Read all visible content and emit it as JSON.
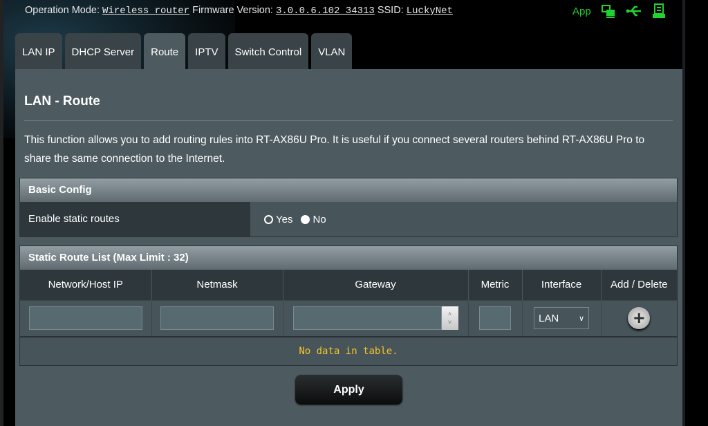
{
  "status": {
    "op_mode_label": "Operation Mode:",
    "op_mode": "Wireless router",
    "fw_label": "Firmware Version:",
    "fw": "3.0.0.6.102_34313",
    "ssid_label": "SSID:",
    "ssid": "LuckyNet",
    "app": "App",
    "icons": [
      "network-status-icon",
      "usb-icon",
      "printer-icon"
    ],
    "accent": "#21d330"
  },
  "tabs": [
    {
      "label": "LAN IP"
    },
    {
      "label": "DHCP Server"
    },
    {
      "label": "Route",
      "active": true
    },
    {
      "label": "IPTV"
    },
    {
      "label": "Switch Control"
    },
    {
      "label": "VLAN"
    }
  ],
  "page": {
    "title": "LAN - Route",
    "description": "This function allows you to add routing rules into RT-AX86U Pro. It is useful if you connect several routers behind RT-AX86U Pro to share the same connection to the Internet."
  },
  "basic": {
    "header": "Basic Config",
    "label": "Enable static routes",
    "yes": "Yes",
    "no": "No",
    "selected": "No"
  },
  "routes": {
    "header": "Static Route List (Max Limit : 32)",
    "columns": [
      "Network/Host IP",
      "Netmask",
      "Gateway",
      "Metric",
      "Interface",
      "Add / Delete"
    ],
    "inputs": {
      "ip": "",
      "netmask": "",
      "gateway": "",
      "metric": ""
    },
    "interface": "LAN",
    "empty": "No data in table."
  },
  "apply": "Apply"
}
